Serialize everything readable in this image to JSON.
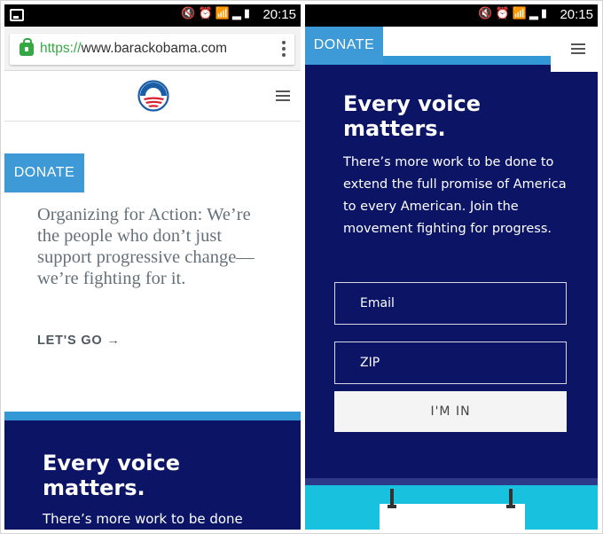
{
  "status_bar": {
    "time": "20:15",
    "icons": [
      "mute-icon",
      "alarm-icon",
      "wifi-icon",
      "signal-icon",
      "battery-icon"
    ]
  },
  "browser": {
    "url_scheme": "https://",
    "url_host": "www.barackobama.com"
  },
  "left_page": {
    "donate_label": "DONATE",
    "intro_text": "Organizing for Action: We’re the people who don’t just support progressive change—we’re fighting for it.",
    "cta_label": "LET'S GO →",
    "section_heading": "Every voice matters.",
    "section_body_start": "There’s more work to be done"
  },
  "right_page": {
    "donate_label": "DONATE",
    "heading": "Every voice matters.",
    "body": "There’s more work to be done to extend the full promise of America to every American. Join the movement fighting for progress.",
    "email_placeholder": "Email",
    "zip_placeholder": "ZIP",
    "submit_label": "I'M IN"
  },
  "colors": {
    "navy": "#0b1465",
    "donate_blue": "#3d9ad6",
    "stripe_blue": "#3399d6",
    "cyan": "#18c1dd",
    "secure_green": "#35a845"
  }
}
